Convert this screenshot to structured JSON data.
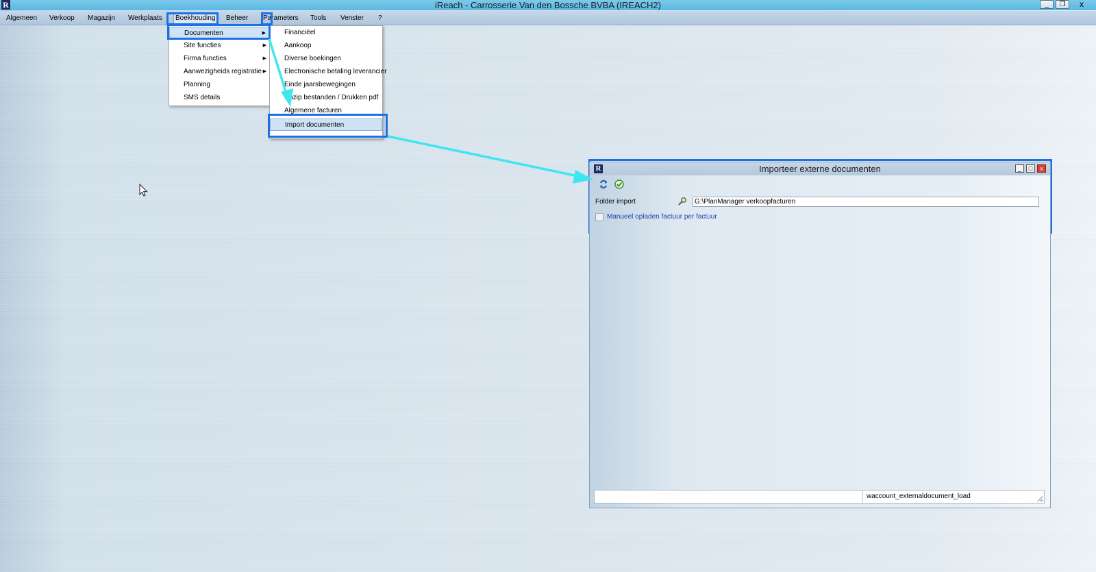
{
  "app": {
    "logo": "R",
    "title": "iReach  - Carrosserie Van den Bossche BVBA  (IREACH2)",
    "window_buttons": [
      "_",
      "❐",
      "x"
    ]
  },
  "menubar": {
    "items": [
      "Algemeen",
      "Verkoop",
      "Magazijn",
      "Werkplaats",
      "Boekhouding",
      "Beheer",
      "Parameters",
      "Tools",
      "Venster",
      "?"
    ],
    "active": "Boekhouding"
  },
  "boekhouding_menu": {
    "items": [
      {
        "label": "Documenten",
        "submenu": true
      },
      {
        "label": "Site functies",
        "submenu": true
      },
      {
        "label": "Firma functies",
        "submenu": true
      },
      {
        "label": "Aanwezigheids registratie",
        "submenu": true
      },
      {
        "label": "Planning",
        "submenu": false
      },
      {
        "label": "SMS details",
        "submenu": false
      }
    ],
    "highlighted": "Documenten"
  },
  "documenten_menu": {
    "items": [
      "Financiëel",
      "Aankoop",
      "Diverse boekingen",
      "Electronische betaling leverancier",
      "Einde jaarsbewegingen",
      "Unzip bestanden / Drukken pdf",
      "Algemene facturen",
      "Import documenten"
    ],
    "highlighted": "Import documenten"
  },
  "import_window": {
    "logo": "R",
    "title": "Importeer externe documenten",
    "buttons": [
      "_",
      "□",
      "x"
    ],
    "toolbar": {
      "refresh_icon": "refresh-icon",
      "confirm_icon": "checkmark-icon"
    },
    "folder_label": "Folder import",
    "folder_value": "G:\\PlanManager verkoopfacturen",
    "checkbox_label": "Manueel opladen factuur per factuur",
    "checkbox_checked": false,
    "status_text": "waccount_externaldocument_load"
  },
  "colors": {
    "highlight_border": "#1e6fe3",
    "arrow": "#40e6ef",
    "titlebar": "#5ab8e2",
    "close_button": "#d3432f"
  }
}
